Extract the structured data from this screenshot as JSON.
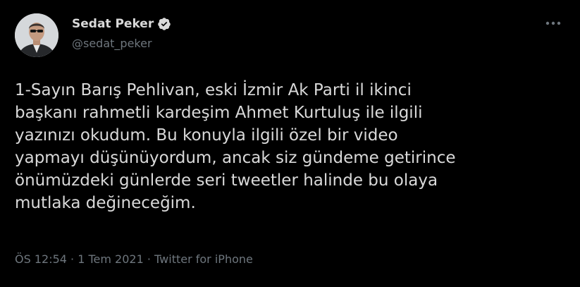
{
  "user": {
    "display_name": "Sedat Peker",
    "handle": "@sedat_peker",
    "verified": true
  },
  "icons": {
    "verified": "verified-badge-icon",
    "more": "more-horizontal-icon",
    "avatar": "profile-photo"
  },
  "tweet": {
    "text": "1-Sayın Barış Pehlivan, eski İzmir Ak Parti il ikinci\nbaşkanı rahmetli kardeşim Ahmet Kurtuluş ile ilgili\nyazınızı okudum. Bu konuyla ilgili özel bir video\nyapmayı düşünüyordum, ancak siz gündeme getirince\nönümüzdeki günlerde seri tweetler halinde bu olaya\nmutlaka değineceğim.",
    "time": "ÖS 12:54",
    "separator": " · ",
    "date": "1 Tem 2021",
    "source": "Twitter for iPhone"
  },
  "colors": {
    "background": "#000000",
    "text": "#d9d9d9",
    "secondary": "#6e767d"
  }
}
